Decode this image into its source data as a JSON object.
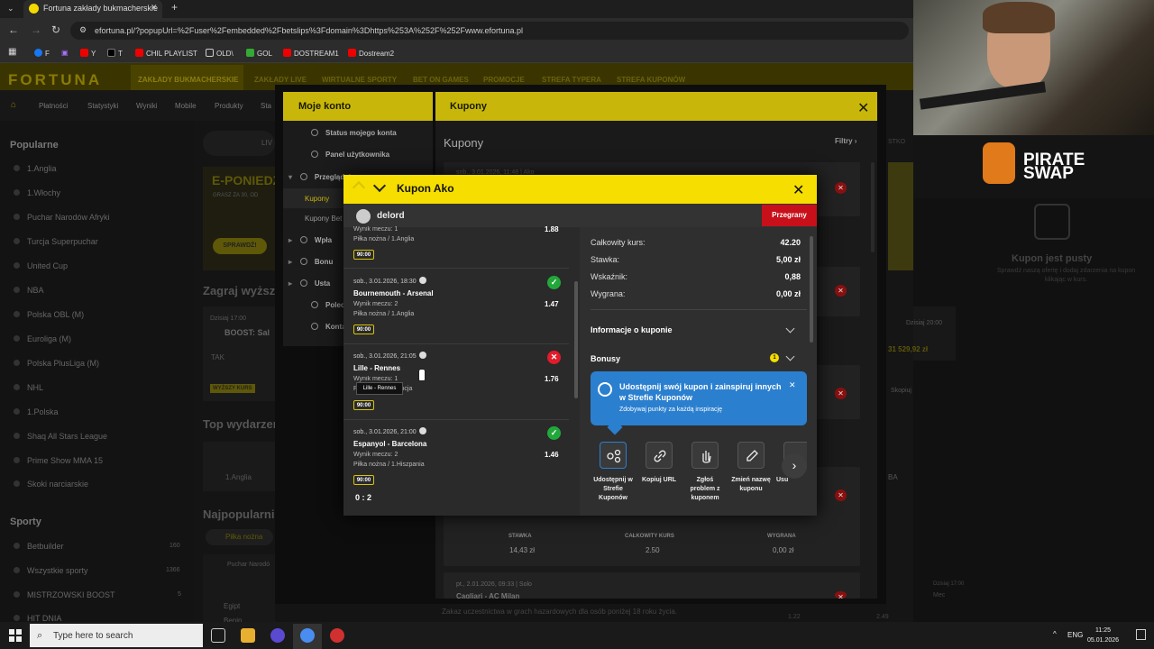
{
  "browser": {
    "tab_title": "Fortuna zakłady bukmacherskie",
    "url": "efortuna.pl/?popupUrl=%2Fuser%2Fembedded%2Fbetslips%3Fdomain%3Dhttps%253A%252F%252Fwww.efortuna.pl",
    "bookmarks": [
      "F",
      "Y",
      "T",
      "CHIL PLAYLIST",
      "OLD\\",
      "GOL",
      "DOSTREAM1",
      "Dostream2"
    ]
  },
  "site": {
    "logo": "FORTUNA",
    "nav": [
      "ZAKŁADY BUKMACHERSKIE",
      "ZAKŁADY LIVE",
      "WIRTUALNE SPORTY",
      "BET ON GAMES",
      "PROMOCJE",
      "STREFA TYPERA",
      "STREFA KUPONÓW"
    ],
    "subnav": [
      "Płatności",
      "Statystyki",
      "Wyniki",
      "Mobile",
      "Produkty",
      "Sta"
    ],
    "popular_heading": "Popularne",
    "popular": [
      "1.Anglia",
      "1.Włochy",
      "Puchar Narodów Afryki",
      "Turcja Superpuchar",
      "United Cup",
      "NBA",
      "Polska OBL (M)",
      "Euroliga (M)",
      "Polska PlusLiga (M)",
      "NHL",
      "1.Polska",
      "Shaq All Stars League",
      "Prime Show MMA 15",
      "Skoki narciarskie"
    ],
    "sports_heading": "Sporty",
    "sports": [
      {
        "name": "Betbuilder",
        "count": "160"
      },
      {
        "name": "Wszystkie sporty",
        "count": "1366"
      },
      {
        "name": "MISTRZOWSKI BOOST",
        "count": "5"
      },
      {
        "name": "HIT DNIA",
        "count": ""
      }
    ],
    "promo_text": "E-PONIEDZ",
    "promo_sub": "GRASZ ZA 30, OD",
    "promo_btn": "SPRAWDŹ!",
    "zagraj": "Zagraj wyższ",
    "boost": "BOOST: Sal",
    "boost_time": "Dzisiaj 17:00",
    "tak": "TAK",
    "wyzszy": "WYŻSZY KURS",
    "top_heading": "Top wydarzer",
    "top_item": "1.Anglia",
    "najpop": "Najpopularnie",
    "pilka": "Piłka nożna",
    "puchar": "Puchar Narodó",
    "egipt": "Egipt",
    "benin": "Benin",
    "footer_note": "Zakaz uczestnictwa w grach hazardowych dla osób poniżej 18 roku życia.",
    "live_label": "LIV",
    "sto": "STKO"
  },
  "moje_konto": {
    "title": "Moje konto",
    "items": [
      "Status mojego konta",
      "Panel użytkownika",
      "Przeglądaj",
      "Kupony",
      "Kupony Bet",
      "Wpła",
      "Bonu",
      "Usta",
      "Polec",
      "Konta"
    ]
  },
  "kupony": {
    "title": "Kupony",
    "heading": "Kupony",
    "filter": "Filtry",
    "card1_date": "sob., 3.01.2026, 11:48 | Ako",
    "stawka_label": "STAWKA",
    "kurs_label": "CAŁKOWITY KURS",
    "wygrana_label": "WYGRANA",
    "stawka_val": "14,43 zł",
    "kurs_val": "2.50",
    "wygrana_val": "0,00 zł",
    "card_last_date": "pt., 2.01.2026, 09:33 | Solo",
    "card_last_team": "Cagliari - AC Milan",
    "empty_title": "Kupon jest pusty",
    "empty_sub": "Sprawdź naszą ofertę i dodaj zdarzenia na kupon klikając w kurs.",
    "side_time": "Dzisiaj 20:00",
    "side_amount": "31 529,92 zł",
    "skopiuj": "Skopiuj",
    "nba": "BA",
    "odd1": "1.22",
    "odd2": "2.49",
    "mec": "Mec",
    "dzisiaj": "Dzisiaj 17:00"
  },
  "modal": {
    "title": "Kupon Ako",
    "user": "delord",
    "status": "Przegrany",
    "events": [
      {
        "date": "",
        "teams": "",
        "result": "Wynik meczu: 1",
        "league": "Piłka nożna / 1.Anglia",
        "odd": "1.88",
        "time": "90:00",
        "state": ""
      },
      {
        "date": "sob., 3.01.2026, 18:30",
        "teams": "Bournemouth - Arsenal",
        "result": "Wynik meczu: 2",
        "league": "Piłka nożna / 1.Anglia",
        "odd": "1.47",
        "time": "90:00",
        "state": "won"
      },
      {
        "date": "sob., 3.01.2026, 21:05",
        "teams": "Lille - Rennes",
        "result": "Wynik meczu: 1",
        "league": "Piłka nożna / Francja",
        "odd": "1.76",
        "time": "90:00",
        "state": "lost"
      },
      {
        "date": "sob., 3.01.2026, 21:00",
        "teams": "Espanyol - Barcelona",
        "result": "Wynik meczu: 2",
        "league": "Piłka nożna / 1.Hiszpania",
        "odd": "1.46",
        "time": "90:00",
        "state": "won"
      }
    ],
    "tooltip": "Lille - Rennes",
    "score": "0 : 2",
    "summary": [
      {
        "label": "Całkowity kurs:",
        "value": "42.20"
      },
      {
        "label": "Stawka:",
        "value": "5,00 zł"
      },
      {
        "label": "Wskaźnik:",
        "value": "0,88"
      },
      {
        "label": "Wygrana:",
        "value": "0,00 zł"
      }
    ],
    "info_label": "Informacje o kuponie",
    "bonus_label": "Bonusy",
    "bonus_count": "1",
    "share_title": "Udostępnij swój kupon i zainspiruj innych w Strefie Kuponów",
    "share_sub": "Zdobywaj punkty za każdą inspirację",
    "actions": [
      "Udostępnij w Strefie Kuponów",
      "Kopiuj URL",
      "Zgłoś problem z kuponem",
      "Zmień nazwę kuponu",
      "Usu"
    ]
  },
  "taskbar": {
    "search_placeholder": "Type here to search",
    "lang": "ENG",
    "time": "11:25",
    "date": "05.01.2026"
  },
  "stream": {
    "brand_line1": "PIRATE",
    "brand_line2": "SWAP"
  },
  "colors": {
    "accent_yellow": "#f5de00",
    "won_green": "#22a83a",
    "lost_red": "#e21b2a",
    "promo_blue": "#2b7fcf"
  }
}
